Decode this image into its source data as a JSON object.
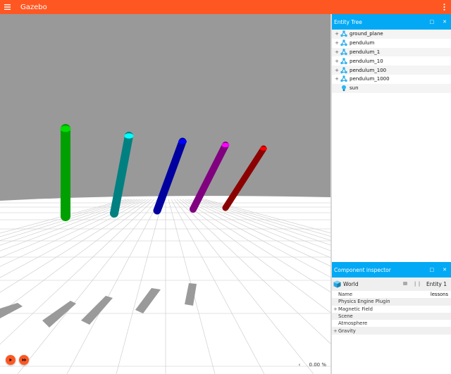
{
  "app": {
    "title": "Gazebo"
  },
  "viewport": {
    "rtf": "0.00 %",
    "rtf_arrow": "‹",
    "sky_color": "#999999",
    "ground_color": "#ffffff",
    "pendulum_colors": [
      "#00a000",
      "#008080",
      "#0000a0",
      "#800080",
      "#8b0000"
    ],
    "pendulum_tip_colors": [
      "#00dd00",
      "#00ffff",
      "#0000ff",
      "#ff00ff",
      "#ff0000"
    ]
  },
  "entity_tree": {
    "title": "Entity Tree",
    "items": [
      {
        "label": "ground_plane",
        "expandable": "+",
        "icon": "model-icon"
      },
      {
        "label": "pendulum",
        "expandable": "+",
        "icon": "model-icon"
      },
      {
        "label": "pendulum_1",
        "expandable": "+",
        "icon": "model-icon"
      },
      {
        "label": "pendulum_10",
        "expandable": "+",
        "icon": "model-icon"
      },
      {
        "label": "pendulum_100",
        "expandable": "+",
        "icon": "model-icon"
      },
      {
        "label": "pendulum_1000",
        "expandable": "+",
        "icon": "model-icon"
      },
      {
        "label": "sun",
        "expandable": "",
        "icon": "light-icon"
      }
    ]
  },
  "component_inspector": {
    "title": "Component inspector",
    "header_name": "World",
    "entity_label": "Entity 1",
    "rows": [
      {
        "label": "Name",
        "value": "lessons",
        "expand": ""
      },
      {
        "label": "Physics Engine Plugin",
        "value": "",
        "expand": ""
      },
      {
        "label": "Magnetic Field",
        "value": "",
        "expand": "+"
      },
      {
        "label": "Scene",
        "value": "",
        "expand": ""
      },
      {
        "label": "Atmosphere",
        "value": "",
        "expand": ""
      },
      {
        "label": "Gravity",
        "value": "",
        "expand": "+"
      }
    ]
  },
  "colors": {
    "accent": "#ff5722",
    "panel_header": "#03a9f4"
  }
}
